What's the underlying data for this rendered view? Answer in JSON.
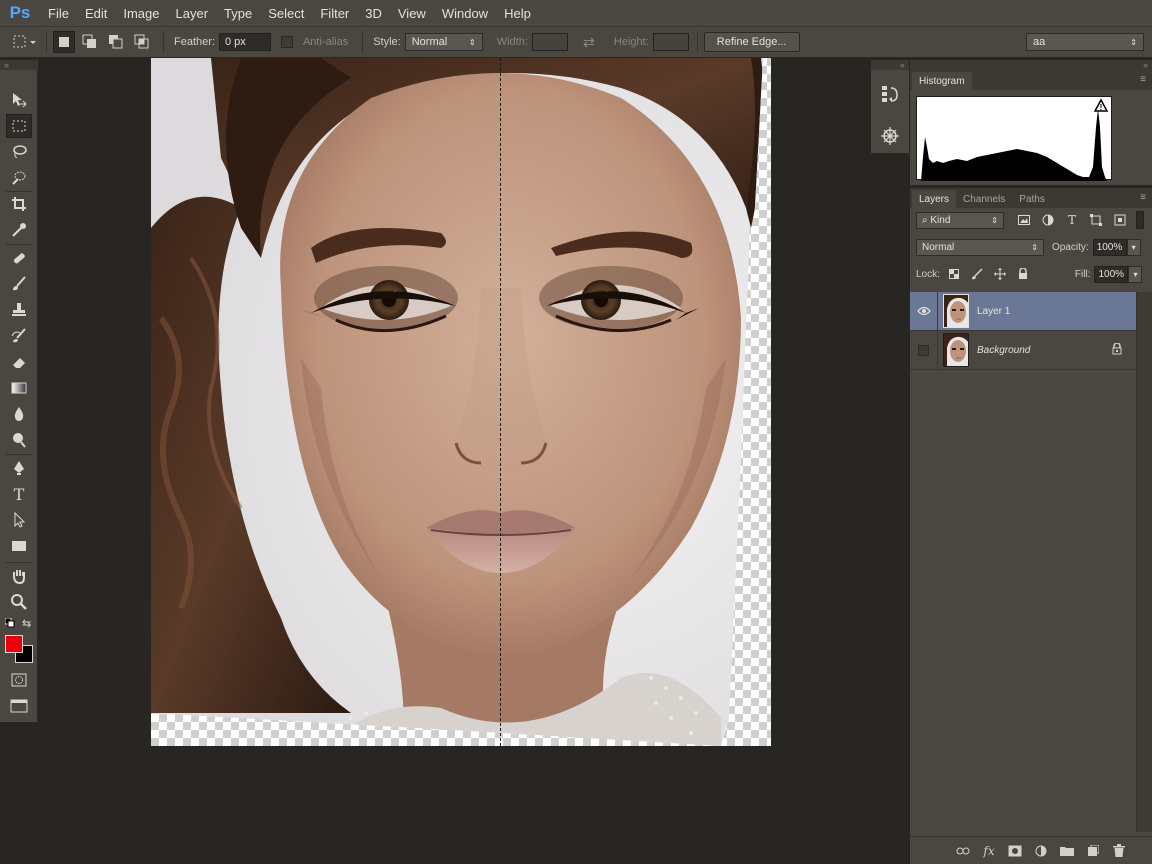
{
  "app": {
    "logo": "Ps"
  },
  "menu": [
    "File",
    "Edit",
    "Image",
    "Layer",
    "Type",
    "Select",
    "Filter",
    "3D",
    "View",
    "Window",
    "Help"
  ],
  "options": {
    "feather_label": "Feather:",
    "feather_value": "0 px",
    "antialias_label": "Anti-alias",
    "style_label": "Style:",
    "style_value": "Normal",
    "width_label": "Width:",
    "height_label": "Height:",
    "refine_edge": "Refine Edge...",
    "workspace_value": "aa"
  },
  "histogram": {
    "tab": "Histogram",
    "warning_icon": "warning-icon"
  },
  "layers_panel": {
    "tabs": [
      "Layers",
      "Channels",
      "Paths"
    ],
    "filter_kind": "Kind",
    "blend_mode": "Normal",
    "opacity_label": "Opacity:",
    "opacity_value": "100%",
    "lock_label": "Lock:",
    "fill_label": "Fill:",
    "fill_value": "100%",
    "layers": [
      {
        "name": "Layer 1",
        "visible": true,
        "selected": true,
        "locked": false
      },
      {
        "name": "Background",
        "visible": false,
        "selected": false,
        "locked": true
      }
    ]
  },
  "colors": {
    "foreground": "#e8000b",
    "background": "#000000",
    "selection": "#6a7895"
  }
}
